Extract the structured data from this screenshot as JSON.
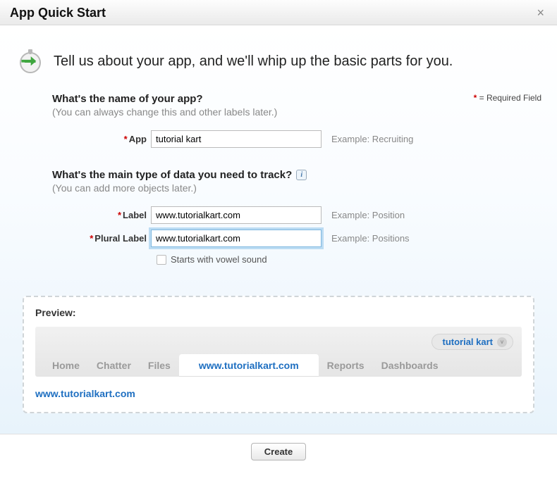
{
  "dialog": {
    "title": "App Quick Start",
    "intro": "Tell us about your app, and we'll whip up the basic parts for you.",
    "required_note_prefix": "*",
    "required_note_text": " = Required Field"
  },
  "section_app": {
    "question": "What's the name of your app?",
    "subtext": "(You can always change this and other labels later.)",
    "field_label": "App",
    "field_value": "tutorial kart",
    "example": "Example: Recruiting"
  },
  "section_data": {
    "question": "What's the main type of data you need to track?",
    "subtext": "(You can add more objects later.)",
    "label_field_label": "Label",
    "label_field_value": "www.tutorialkart.com",
    "label_example": "Example: Position",
    "plural_field_label": "Plural Label",
    "plural_field_value": "www.tutorialkart.com",
    "plural_example": "Example: Positions",
    "vowel_checkbox": "Starts with vowel sound"
  },
  "preview": {
    "title": "Preview:",
    "app_name": "tutorial kart",
    "tabs": [
      "Home",
      "Chatter",
      "Files",
      "www.tutorialkart.com",
      "Reports",
      "Dashboards"
    ],
    "active_tab_index": 3,
    "link_text": "www.tutorialkart.com"
  },
  "footer": {
    "create_label": "Create"
  }
}
